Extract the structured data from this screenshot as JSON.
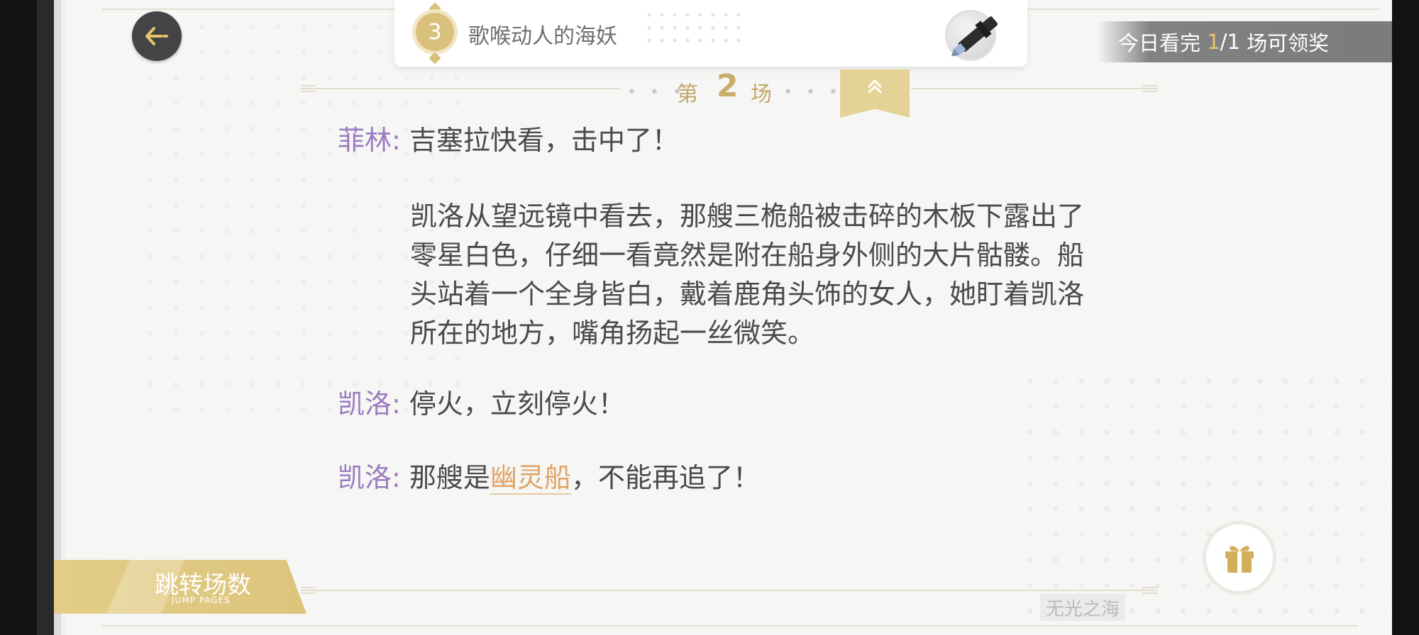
{
  "header": {
    "chapter_number": "3",
    "chapter_title": "歌喉动人的海妖"
  },
  "reward_banner": {
    "prefix": "今日看完 ",
    "progress": "1",
    "total": "/1",
    "suffix": " 场可领奖"
  },
  "scene": {
    "prefix": "第",
    "number": "2",
    "suffix": "场",
    "dots": "• • •"
  },
  "dialogue": [
    {
      "speaker": "菲林:",
      "text": "吉塞拉快看，击中了！"
    },
    {
      "narration": [
        "凯洛从望远镜中看去，那艘三桅船被击碎的木板下露出了",
        "零星白色，仔细一看竟然是附在船身外侧的大片骷髅。船",
        "头站着一个全身皆白，戴着鹿角头饰的女人，她盯着凯洛",
        "所在的地方，嘴角扬起一丝微笑。"
      ]
    },
    {
      "speaker": "凯洛:",
      "text": "停火，立刻停火！"
    },
    {
      "speaker": "凯洛:",
      "text_before": "那艘是",
      "keyword": "幽灵船",
      "text_after": "，不能再追了！"
    }
  ],
  "bottom": {
    "jump_label": "跳转场数",
    "jump_sub": "JUMP PAGES",
    "watermark": "无光之海"
  },
  "icons": [
    "back-arrow-icon",
    "pen-icon",
    "collapse-chevron-icon",
    "gift-icon"
  ],
  "colors": {
    "accent_gold": "#d9c17d",
    "speaker_purple": "#9b7cc0",
    "keyword_orange": "#e0a565",
    "body_text": "#4a4a4a"
  }
}
